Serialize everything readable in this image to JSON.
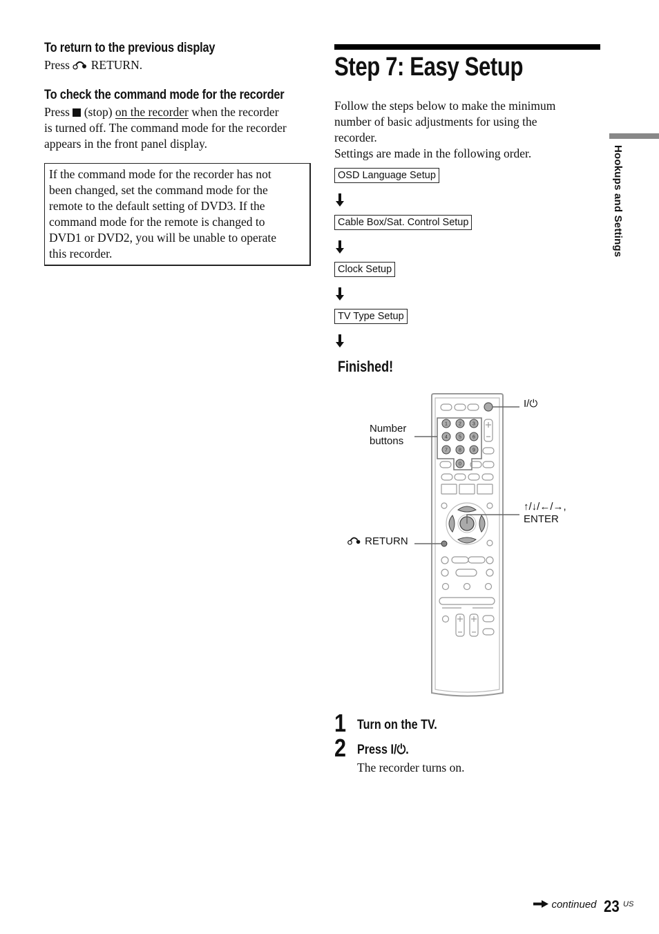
{
  "left_column": {
    "return_section": {
      "heading": "To return to the previous display",
      "text_before": "Press",
      "icon": "return-icon",
      "text_after": "RETURN."
    },
    "command_mode_section": {
      "heading": "To check the command mode for the recorder",
      "line1_before": "Press",
      "stop_icon": "stop-icon",
      "line1_mid": "(stop)",
      "line1_link": "on the recorder",
      "line1_after": "when the recorder",
      "line2": "is turned off. The command mode for the recorder",
      "line3": "appears in the front panel display."
    },
    "note_box": {
      "lines": [
        "If the command mode for the recorder has not",
        "been changed, set the command mode for the",
        "remote to the default setting of DVD3. If the",
        "command mode for the remote is changed to",
        "DVD1 or DVD2, you will be unable to operate",
        "this recorder."
      ]
    }
  },
  "right_column": {
    "title": "Step 7: Easy Setup",
    "intro_lines": [
      "Follow the steps below to make the minimum",
      "number of basic adjustments for using the",
      "recorder.",
      "Settings are made in the following order."
    ],
    "flow": [
      {
        "label": "OSD Language Setup"
      },
      {
        "label": "Cable Box/Sat. Control Setup"
      },
      {
        "label": "Clock Setup"
      },
      {
        "label": "TV Type Setup"
      }
    ],
    "finished_label": "Finished!",
    "remote_callouts": {
      "power": "I/⏻",
      "number_buttons_line1": "Number",
      "number_buttons_line2": "buttons",
      "arrows_line1": "↑/↓/←/→,",
      "arrows_line2": "ENTER",
      "return": "RETURN"
    },
    "remote_number_keys": [
      "1",
      "2",
      "3",
      "4",
      "5",
      "6",
      "7",
      "8",
      "9",
      "0"
    ],
    "steps": [
      {
        "number": "1",
        "text": "Turn on the TV.",
        "detail": ""
      },
      {
        "number": "2",
        "text": "Press I/⏻.",
        "detail": "The recorder turns on."
      }
    ]
  },
  "side_tab": {
    "label": "Hookups and Settings",
    "color": "#888888"
  },
  "footer": {
    "continued": "continued",
    "page_number": "23",
    "page_suffix": "US"
  }
}
